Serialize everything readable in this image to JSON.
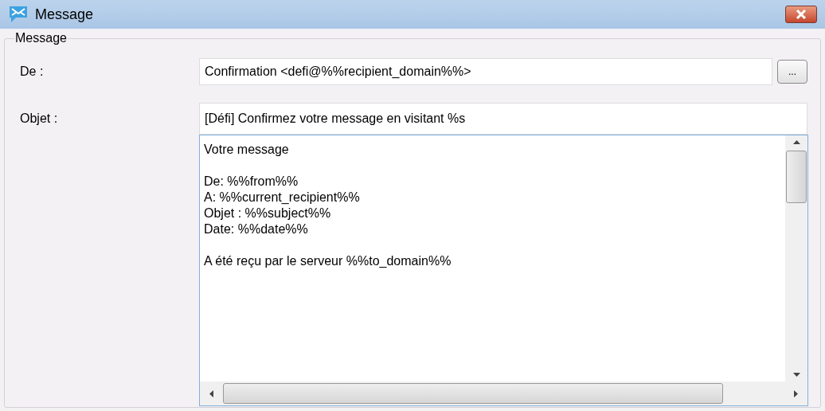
{
  "window": {
    "title": "Message"
  },
  "group": {
    "legend": "Message"
  },
  "fields": [
    {
      "label": "De :",
      "value": "Confirmation <defi@%%recipient_domain%%>",
      "button": "..."
    },
    {
      "label": "Objet :",
      "value": "[Défi] Confirmez votre message en visitant %s"
    }
  ],
  "body": [
    [
      "Votre message"
    ],
    [
      "De: %%from%%",
      "A: %%current_recipient%%",
      "Objet : %%subject%%",
      "Date: %%date%%"
    ],
    [
      "A été reçu par le serveur %%to_domain%%"
    ]
  ]
}
